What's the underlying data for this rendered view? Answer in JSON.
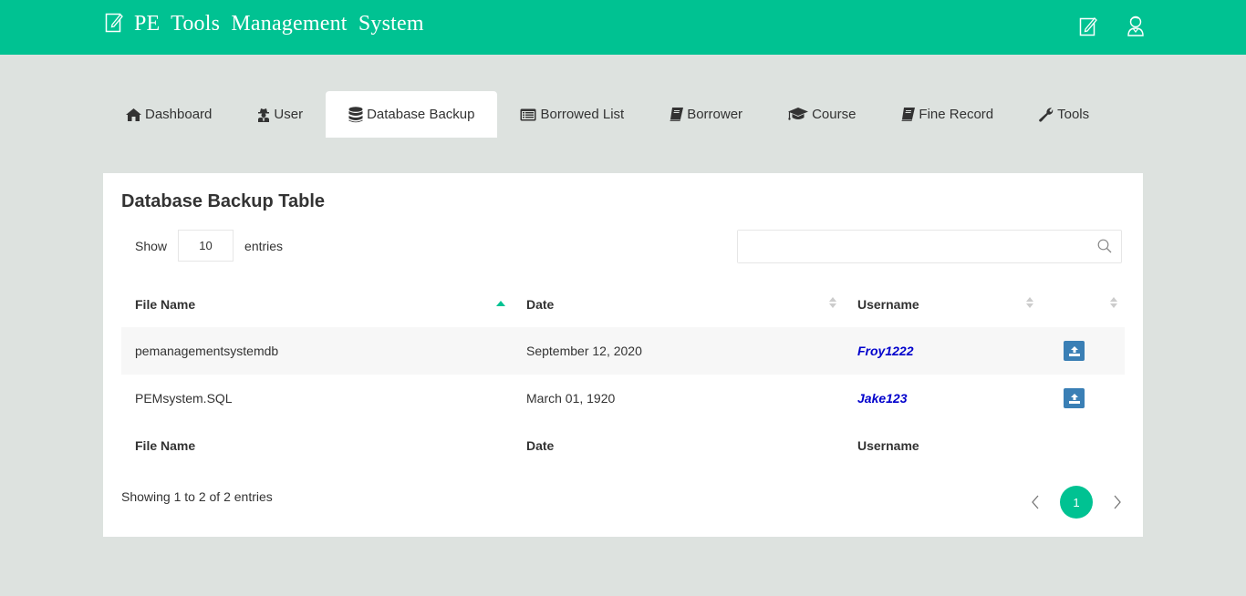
{
  "header": {
    "title": "PE Tools Management System",
    "brand_icon": "edit-note-icon",
    "actions": [
      {
        "name": "edit-note-icon"
      },
      {
        "name": "user-profile-icon"
      }
    ]
  },
  "tabs": [
    {
      "label": "Dashboard",
      "icon": "home-icon",
      "active": false
    },
    {
      "label": "User",
      "icon": "user-secret-icon",
      "active": false
    },
    {
      "label": "Database Backup",
      "icon": "database-icon",
      "active": true
    },
    {
      "label": "Borrowed List",
      "icon": "list-alt-icon",
      "active": false
    },
    {
      "label": "Borrower",
      "icon": "book-icon",
      "active": false
    },
    {
      "label": "Course",
      "icon": "graduation-cap-icon",
      "active": false
    },
    {
      "label": "Fine Record",
      "icon": "book-icon",
      "active": false
    },
    {
      "label": "Tools",
      "icon": "wrench-icon",
      "active": false
    }
  ],
  "card": {
    "title": "Database Backup Table",
    "length": {
      "show_label": "Show",
      "value": "10",
      "entries_label": "entries"
    },
    "search": {
      "value": "",
      "placeholder": ""
    },
    "table": {
      "columns": [
        "File Name",
        "Date",
        "Username",
        ""
      ],
      "sorted_column": "File Name",
      "sort_direction": "asc",
      "rows": [
        {
          "file_name": "pemanagementsystemdb",
          "date": "September 12, 2020",
          "username": "Froy1222",
          "action": "upload-icon"
        },
        {
          "file_name": "PEMsystem.SQL",
          "date": "March 01, 1920",
          "username": "Jake123",
          "action": "upload-icon"
        }
      ],
      "footer": [
        "File Name",
        "Date",
        "Username",
        ""
      ]
    },
    "info": "Showing 1 to 2 of 2 entries",
    "pagination": {
      "current": "1",
      "pages": [
        "1"
      ]
    }
  },
  "colors": {
    "brand": "#00c292",
    "background": "#dde2df",
    "link": "#0000cc",
    "button": "#3a7fb5"
  }
}
